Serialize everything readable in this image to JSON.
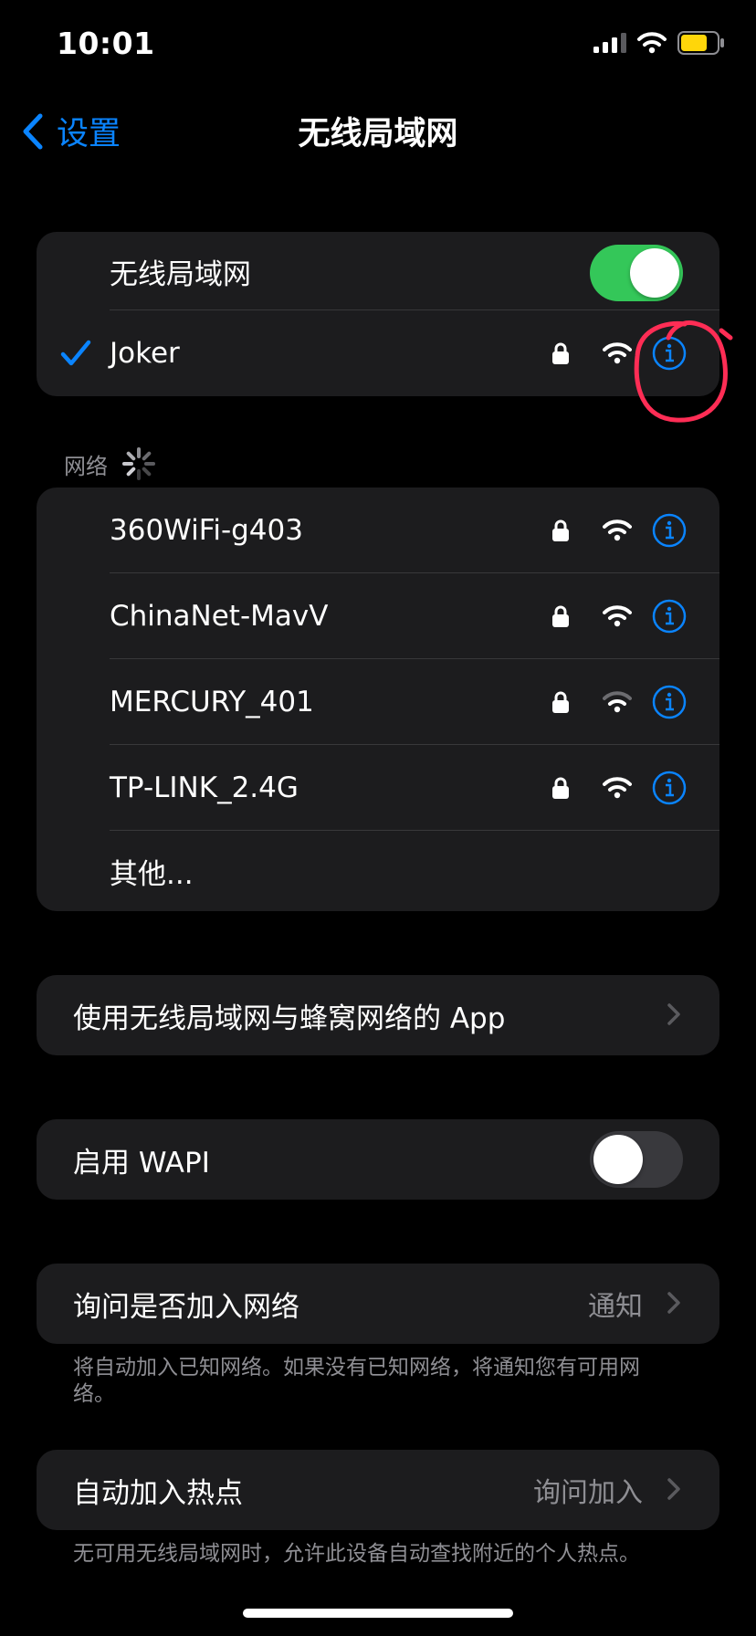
{
  "status_bar": {
    "time": "10:01"
  },
  "nav": {
    "back_label": "设置",
    "title": "无线局域网"
  },
  "wifi_group": {
    "toggle_label": "无线局域网",
    "toggle_on": true,
    "connected_network": "Joker"
  },
  "networks": {
    "header": "网络",
    "items": [
      {
        "name": "360WiFi-g403",
        "secured": true,
        "signal": 3
      },
      {
        "name": "ChinaNet-MavV",
        "secured": true,
        "signal": 3
      },
      {
        "name": "MERCURY_401",
        "secured": true,
        "signal": 2
      },
      {
        "name": "TP-LINK_2.4G",
        "secured": true,
        "signal": 3
      }
    ],
    "other_label": "其他..."
  },
  "apps_row": {
    "label": "使用无线局域网与蜂窝网络的 App"
  },
  "wapi_row": {
    "label": "启用 WAPI",
    "toggle_on": false
  },
  "ask_join": {
    "label": "询问是否加入网络",
    "value": "通知",
    "footnote": "将自动加入已知网络。如果没有已知网络，将通知您有可用网络。"
  },
  "auto_hotspot": {
    "label": "自动加入热点",
    "value": "询问加入",
    "footnote": "无可用无线局域网时，允许此设备自动查找附近的个人热点。"
  },
  "colors": {
    "accent": "#0a84ff",
    "toggle_on": "#34c759",
    "annotation": "#ff2d55"
  },
  "icons": [
    "chevron-left-icon",
    "checkmark-icon",
    "lock-icon",
    "wifi-icon",
    "info-icon",
    "chevron-right-icon",
    "spinner-icon"
  ]
}
